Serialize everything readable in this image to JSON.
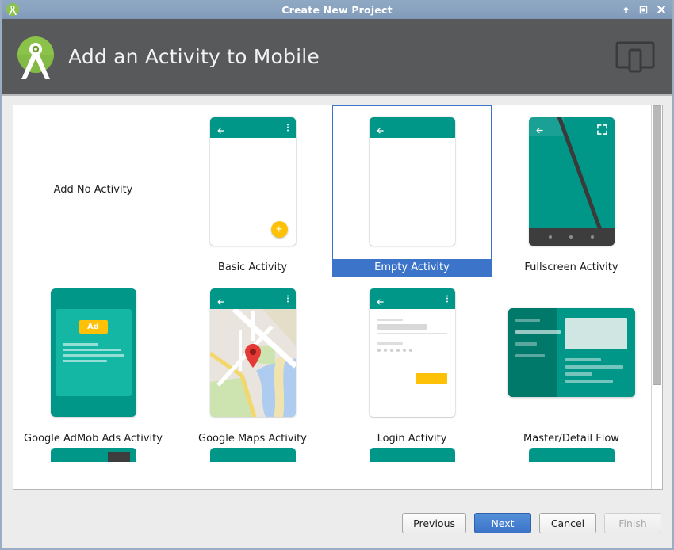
{
  "window": {
    "title": "Create New Project",
    "app_icon": "android-studio-icon",
    "controls": [
      {
        "name": "minimize-button",
        "glyph": "↑"
      },
      {
        "name": "maximize-button",
        "glyph": "□"
      },
      {
        "name": "close-button",
        "glyph": "✕"
      }
    ]
  },
  "header": {
    "title": "Add an Activity to Mobile",
    "logo": "android-studio-logo",
    "device_icon": "mobile-device-icon"
  },
  "colors": {
    "titlebar": "#8fa9c4",
    "header_bg": "#58595b",
    "accent_teal": "#009688",
    "accent_teal_dark": "#00796b",
    "selection_blue": "#3b74c9",
    "fab_amber": "#ffc107",
    "map_red": "#e53935",
    "panel_bg": "#ececec"
  },
  "gallery": {
    "selected": "Empty Activity",
    "items": [
      {
        "label": "Add No Activity",
        "thumb": "none",
        "selected": false
      },
      {
        "label": "Basic Activity",
        "thumb": "basic",
        "selected": false
      },
      {
        "label": "Empty Activity",
        "thumb": "empty",
        "selected": true
      },
      {
        "label": "Fullscreen Activity",
        "thumb": "fullscreen",
        "selected": false
      },
      {
        "label": "Google AdMob Ads Activity",
        "thumb": "admob",
        "selected": false
      },
      {
        "label": "Google Maps Activity",
        "thumb": "maps",
        "selected": false
      },
      {
        "label": "Login Activity",
        "thumb": "login",
        "selected": false
      },
      {
        "label": "Master/Detail Flow",
        "thumb": "masterdetail",
        "selected": false
      }
    ],
    "admob_badge": "Ad",
    "scrollbar": {
      "name": "vertical-scrollbar",
      "thumb_fraction": 0.73
    }
  },
  "footer": {
    "previous_label": "Previous",
    "next_label": "Next",
    "cancel_label": "Cancel",
    "finish_label": "Finish",
    "finish_disabled": true
  }
}
